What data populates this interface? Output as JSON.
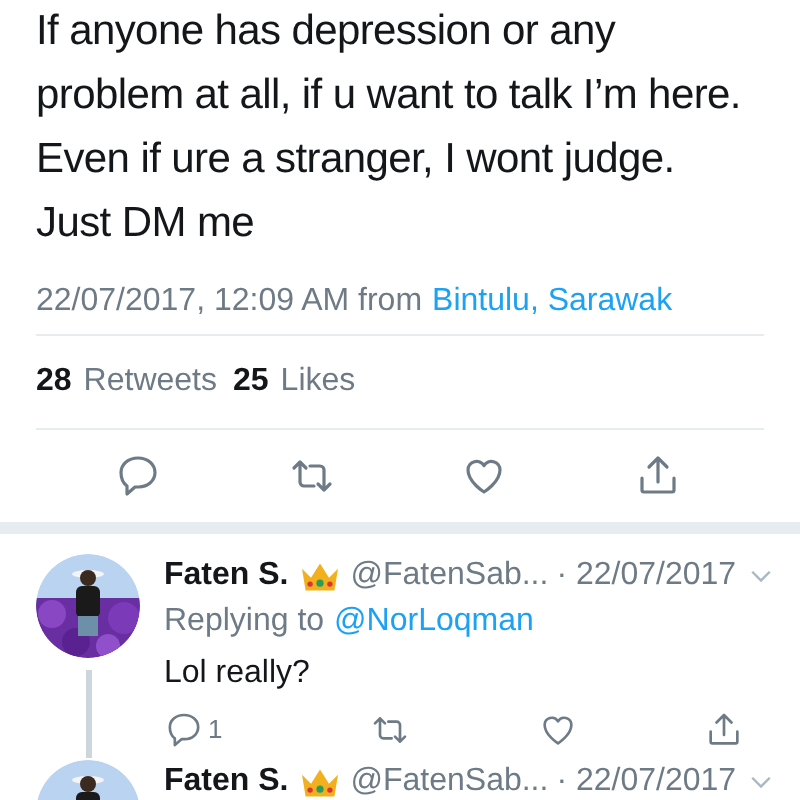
{
  "tweet": {
    "text": "If anyone has depression or any problem at all, if u want to talk I’m here. Even if ure a stranger, I wont judge. Just DM me",
    "timestamp": "22/07/2017, 12:09 AM from",
    "location": "Bintulu, Sarawak",
    "retweets_count": "28",
    "retweets_label": "Retweets",
    "likes_count": "25",
    "likes_label": "Likes"
  },
  "replies": [
    {
      "name": "Faten S.",
      "handle": "@FatenSab...",
      "date": "· 22/07/2017",
      "replying_label": "Replying to",
      "replying_to": "@NorLoqman",
      "text": "Lol really?",
      "reply_count": "1",
      "thread_line": true
    },
    {
      "name": "Faten S.",
      "handle": "@FatenSab...",
      "date": "· 22/07/2017"
    }
  ]
}
